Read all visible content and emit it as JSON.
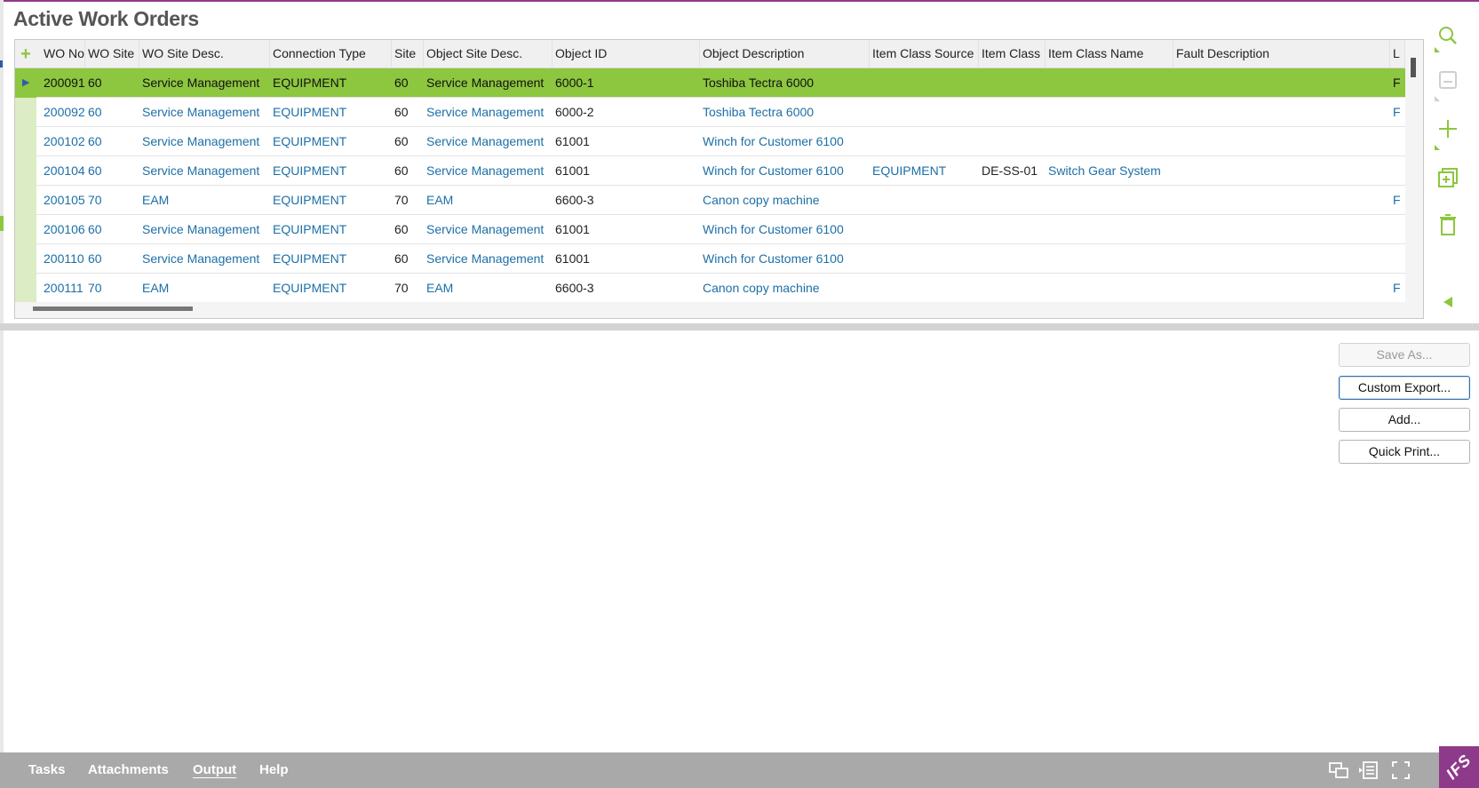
{
  "page": {
    "title": "Active Work Orders"
  },
  "grid": {
    "add_symbol": "+",
    "columns": [
      "WO No",
      "WO Site",
      "WO Site Desc.",
      "Connection Type",
      "Site",
      "Object Site Desc.",
      "Object ID",
      "Object Description",
      "Item Class Source",
      "Item Class",
      "Item Class Name",
      "Fault Description",
      "L"
    ],
    "rows": [
      {
        "wo_no": "200091",
        "wo_site": "60",
        "wo_site_desc": "Service Management",
        "conn_type": "EQUIPMENT",
        "site": "60",
        "obj_site_desc": "Service Management",
        "obj_id": "6000-1",
        "obj_desc": "Toshiba Tectra 6000",
        "ic_source": "",
        "item_class": "",
        "ic_name": "",
        "fault": "",
        "l": "F",
        "active": true
      },
      {
        "wo_no": "200092",
        "wo_site": "60",
        "wo_site_desc": "Service Management",
        "conn_type": "EQUIPMENT",
        "site": "60",
        "obj_site_desc": "Service Management",
        "obj_id": "6000-2",
        "obj_desc": "Toshiba Tectra 6000",
        "ic_source": "",
        "item_class": "",
        "ic_name": "",
        "fault": "",
        "l": "F"
      },
      {
        "wo_no": "200102",
        "wo_site": "60",
        "wo_site_desc": "Service Management",
        "conn_type": "EQUIPMENT",
        "site": "60",
        "obj_site_desc": "Service Management",
        "obj_id": "61001",
        "obj_desc": "Winch for Customer 6100",
        "ic_source": "",
        "item_class": "",
        "ic_name": "",
        "fault": "",
        "l": ""
      },
      {
        "wo_no": "200104",
        "wo_site": "60",
        "wo_site_desc": "Service Management",
        "conn_type": "EQUIPMENT",
        "site": "60",
        "obj_site_desc": "Service Management",
        "obj_id": "61001",
        "obj_desc": "Winch for Customer 6100",
        "ic_source": "EQUIPMENT",
        "item_class": "DE-SS-01",
        "ic_name": "Switch Gear System",
        "fault": "",
        "l": ""
      },
      {
        "wo_no": "200105",
        "wo_site": "70",
        "wo_site_desc": "EAM",
        "conn_type": "EQUIPMENT",
        "site": "70",
        "obj_site_desc": "EAM",
        "obj_id": "6600-3",
        "obj_desc": "Canon copy machine",
        "ic_source": "",
        "item_class": "",
        "ic_name": "",
        "fault": "",
        "l": "F"
      },
      {
        "wo_no": "200106",
        "wo_site": "60",
        "wo_site_desc": "Service Management",
        "conn_type": "EQUIPMENT",
        "site": "60",
        "obj_site_desc": "Service Management",
        "obj_id": "61001",
        "obj_desc": "Winch for Customer 6100",
        "ic_source": "",
        "item_class": "",
        "ic_name": "",
        "fault": "",
        "l": ""
      },
      {
        "wo_no": "200110",
        "wo_site": "60",
        "wo_site_desc": "Service Management",
        "conn_type": "EQUIPMENT",
        "site": "60",
        "obj_site_desc": "Service Management",
        "obj_id": "61001",
        "obj_desc": "Winch for Customer 6100",
        "ic_source": "",
        "item_class": "",
        "ic_name": "",
        "fault": "",
        "l": ""
      },
      {
        "wo_no": "200111",
        "wo_site": "70",
        "wo_site_desc": "EAM",
        "conn_type": "EQUIPMENT",
        "site": "70",
        "obj_site_desc": "EAM",
        "obj_id": "6600-3",
        "obj_desc": "Canon copy machine",
        "ic_source": "",
        "item_class": "",
        "ic_name": "",
        "fault": "",
        "l": "F"
      }
    ]
  },
  "side_toolbar": {
    "icons": [
      "search-icon",
      "save-icon",
      "add-icon",
      "duplicate-icon",
      "delete-icon",
      "collapse-icon"
    ]
  },
  "output_panel": {
    "save_as": "Save As...",
    "custom_export": "Custom Export...",
    "add": "Add...",
    "quick_print": "Quick Print..."
  },
  "bottom_bar": {
    "tasks": "Tasks",
    "attachments": "Attachments",
    "output": "Output",
    "help": "Help",
    "active_tab": "Output",
    "logo_text": "IFS"
  },
  "colors": {
    "accent_green": "#8dc63f",
    "link_blue": "#1d6fa6",
    "brand_purple": "#8e3a8a",
    "bottom_bar_gray": "#a9a9a9"
  }
}
